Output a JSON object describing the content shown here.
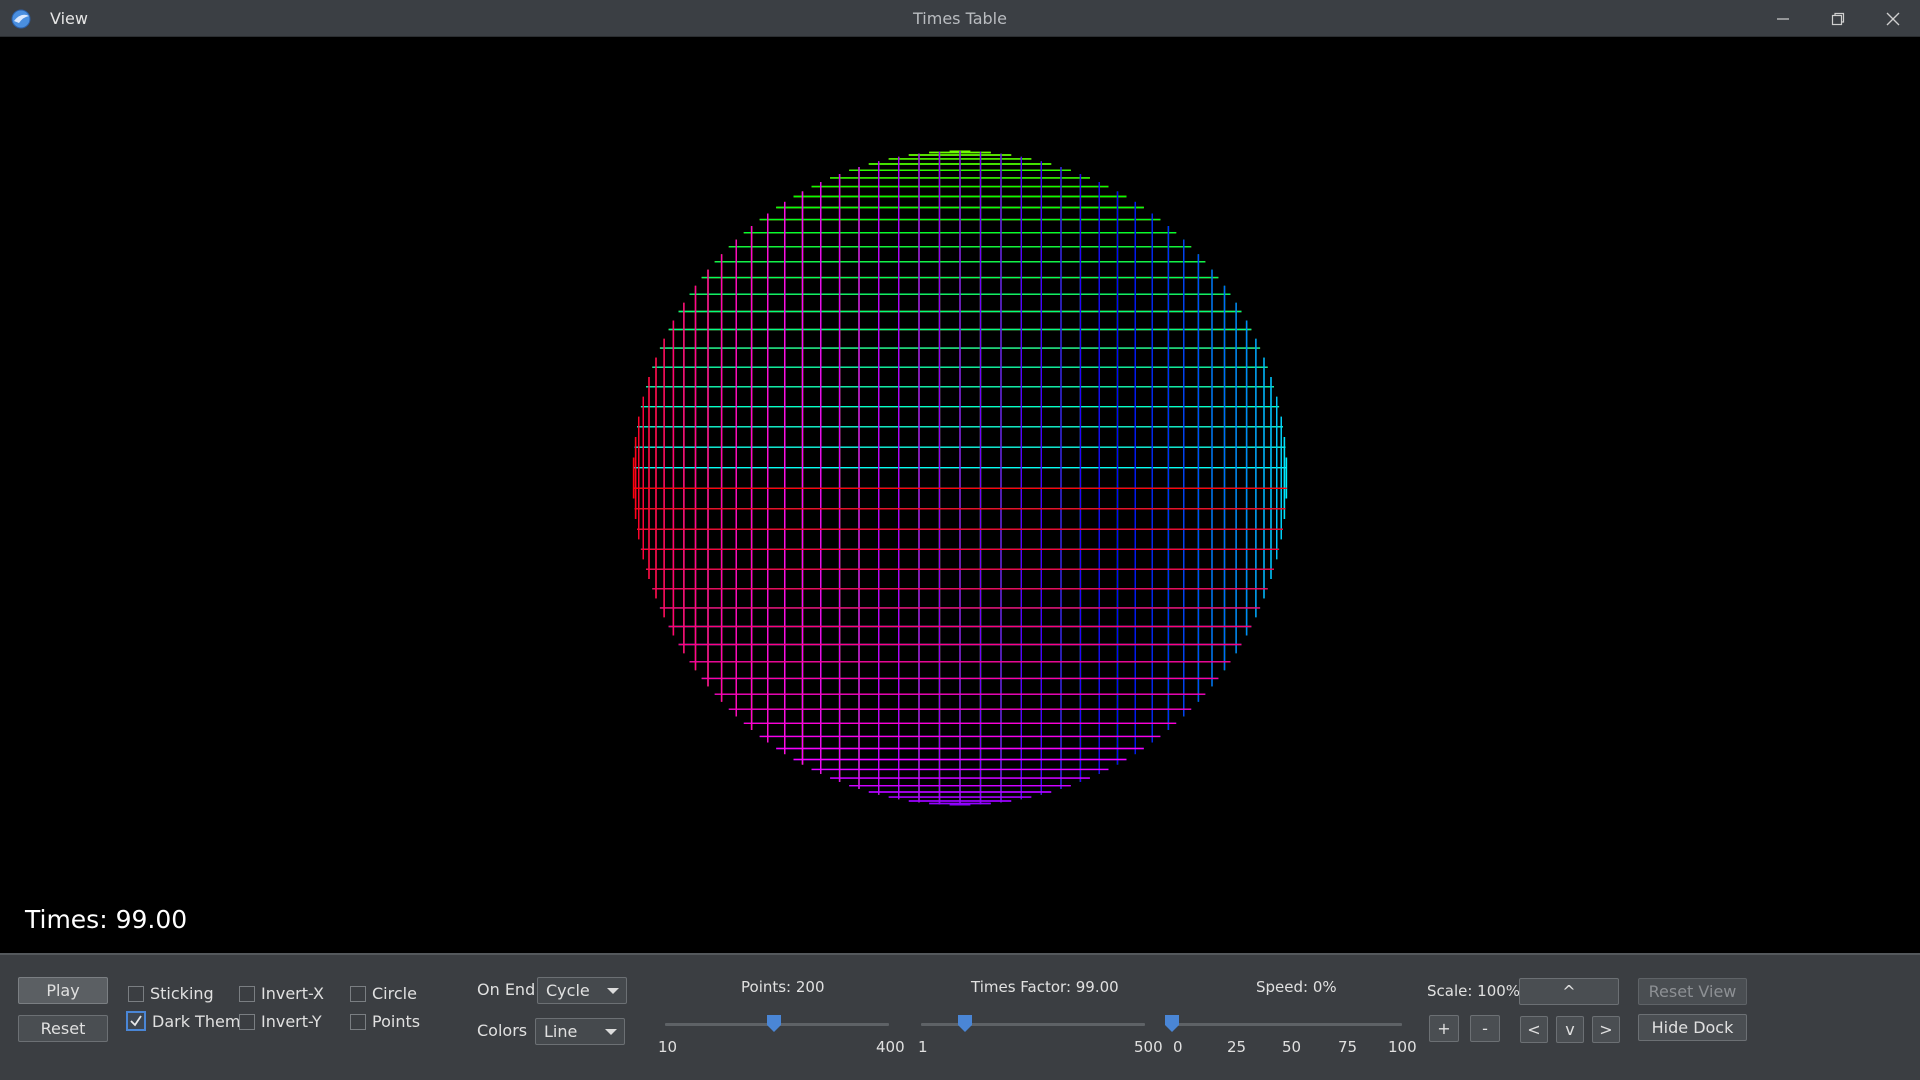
{
  "window": {
    "menu_view": "View",
    "title": "Times Table"
  },
  "canvas": {
    "times_text": "Times: 99.00",
    "points": 200,
    "times_factor": 99.0,
    "background": "#000000"
  },
  "dock": {
    "play_label": "Play",
    "reset_label": "Reset",
    "checkboxes": {
      "sticking": {
        "label": "Sticking",
        "checked": false
      },
      "dark_theme": {
        "label": "Dark Theme",
        "checked": true
      },
      "invert_x": {
        "label": "Invert-X",
        "checked": false
      },
      "invert_y": {
        "label": "Invert-Y",
        "checked": false
      },
      "circle": {
        "label": "Circle",
        "checked": false
      },
      "points": {
        "label": "Points",
        "checked": false
      }
    },
    "on_end": {
      "label": "On End",
      "value": "Cycle"
    },
    "colors": {
      "label": "Colors",
      "value": "Line"
    },
    "points_slider": {
      "label": "Points: 200",
      "min_label": "10",
      "max_label": "400",
      "value": 200,
      "min": 10,
      "max": 400
    },
    "times_slider": {
      "label": "Times Factor: 99.00",
      "min_label": "1",
      "max_label": "500",
      "value": 99,
      "min": 1,
      "max": 500
    },
    "speed_slider": {
      "label": "Speed: 0%",
      "ticks": [
        "0",
        "25",
        "50",
        "75",
        "100"
      ],
      "value": 0
    },
    "scale_label": "Scale: 100%",
    "plus_label": "+",
    "minus_label": "-",
    "up_label": "^",
    "left_label": "<",
    "down_label": "v",
    "right_label": ">",
    "reset_view_label": "Reset View",
    "hide_dock_label": "Hide Dock"
  },
  "colors": {
    "accent": "#4a86d6",
    "dock_bg": "#3b3e42",
    "titlebar_bg": "#3b3f44"
  }
}
